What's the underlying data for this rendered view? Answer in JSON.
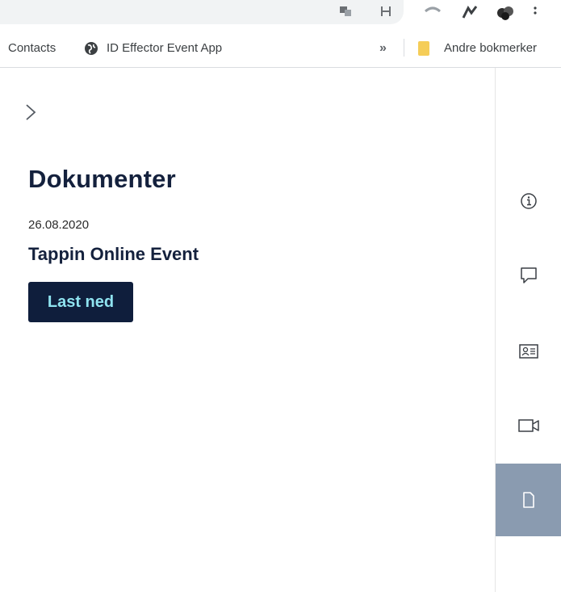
{
  "bookmarks_bar": {
    "items": [
      {
        "label": "Contacts"
      },
      {
        "label": "ID Effector Event App",
        "icon": "globe-icon"
      }
    ],
    "overflow_label": "»",
    "folder": {
      "label": "Andre bokmerker",
      "icon": "folder-icon"
    }
  },
  "main": {
    "heading": "Dokumenter",
    "document": {
      "date": "26.08.2020",
      "title": "Tappin Online Event",
      "download_label": "Last ned"
    }
  },
  "sidebar": {
    "items": [
      {
        "icon": "info-icon"
      },
      {
        "icon": "chat-icon"
      },
      {
        "icon": "contact-card-icon"
      },
      {
        "icon": "video-icon"
      },
      {
        "icon": "document-icon",
        "active": true
      }
    ]
  },
  "colors": {
    "heading": "#14213d",
    "button_bg": "#0f1e3c",
    "button_text": "#8fe3f0",
    "sidebar_active": "#8a9bb0",
    "folder": "#f5cd58"
  }
}
